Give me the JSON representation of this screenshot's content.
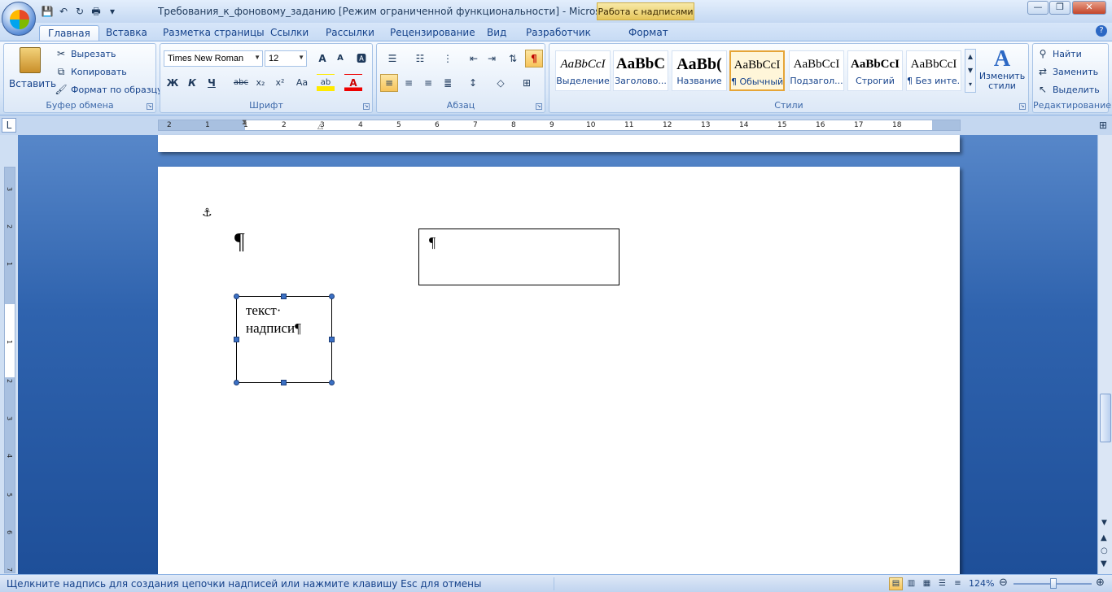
{
  "window": {
    "title": "Требования_к_фоновому_заданию [Режим ограниченной функциональности] - Microsoft W...",
    "context_tab": "Работа с надписями",
    "minimize": "—",
    "restore": "❐",
    "close": "✕"
  },
  "qat": {
    "save_icon": "💾",
    "undo_icon": "↶",
    "redo_icon": "↻",
    "print_icon": "🖶",
    "more_icon": "▾"
  },
  "tabs": [
    "Главная",
    "Вставка",
    "Разметка страницы",
    "Ссылки",
    "Рассылки",
    "Рецензирование",
    "Вид",
    "Разработчик",
    "Формат"
  ],
  "help_icon": "?",
  "clipboard": {
    "paste_label": "Вставить",
    "cut_label": "Вырезать",
    "copy_label": "Копировать",
    "format_painter_label": "Формат по образцу",
    "group_label": "Буфер обмена"
  },
  "font": {
    "font_name": "Times New Roman",
    "font_size": "12",
    "group_label": "Шрифт",
    "grow": "A",
    "shrink": "A",
    "clear": "🅰",
    "bold": "Ж",
    "italic": "К",
    "underline": "Ч",
    "strike": "abc",
    "subscript": "x₂",
    "superscript": "x²",
    "case": "Aa",
    "highlight": "ab",
    "color": "A"
  },
  "paragraph": {
    "group_label": "Абзац",
    "show_marks": "¶"
  },
  "styles": {
    "group_label": "Стили",
    "items": [
      {
        "sample": "AaBbCcI",
        "name": "Выделение"
      },
      {
        "sample": "AaBbC",
        "name": "Заголово..."
      },
      {
        "sample": "AaBb(",
        "name": "Название"
      },
      {
        "sample": "AaBbCcI",
        "name": "¶ Обычный"
      },
      {
        "sample": "AaBbCcI",
        "name": "Подзагол..."
      },
      {
        "sample": "AaBbCcI",
        "name": "Строгий"
      },
      {
        "sample": "AaBbCcI",
        "name": "¶ Без инте..."
      }
    ],
    "change_label": "Изменить стили",
    "change_label_l1": "Изменить",
    "change_label_l2": "стили"
  },
  "editing": {
    "group_label": "Редактирование",
    "find_label": "Найти",
    "replace_label": "Заменить",
    "select_label": "Выделить"
  },
  "ruler": {
    "tab_selector": "L",
    "h_ticks": [
      "2",
      "1",
      "1",
      "2",
      "3",
      "4",
      "5",
      "6",
      "7",
      "8",
      "9",
      "10",
      "11",
      "12",
      "13",
      "14",
      "15",
      "16",
      "17",
      "18"
    ],
    "v_ticks": [
      "3",
      "2",
      "1",
      "1",
      "2",
      "3",
      "4",
      "5",
      "6",
      "7"
    ]
  },
  "document": {
    "anchor": "⚓",
    "para_mark": "¶",
    "textbox1_mark": "¶",
    "textbox2_text": "текст·\nнадписи¶"
  },
  "status": {
    "message": "Щелкните надпись для создания цепочки надписей или нажмите клавишу Esc для отмены",
    "zoom": "124%",
    "zoom_out": "⊖",
    "zoom_in": "⊕"
  }
}
